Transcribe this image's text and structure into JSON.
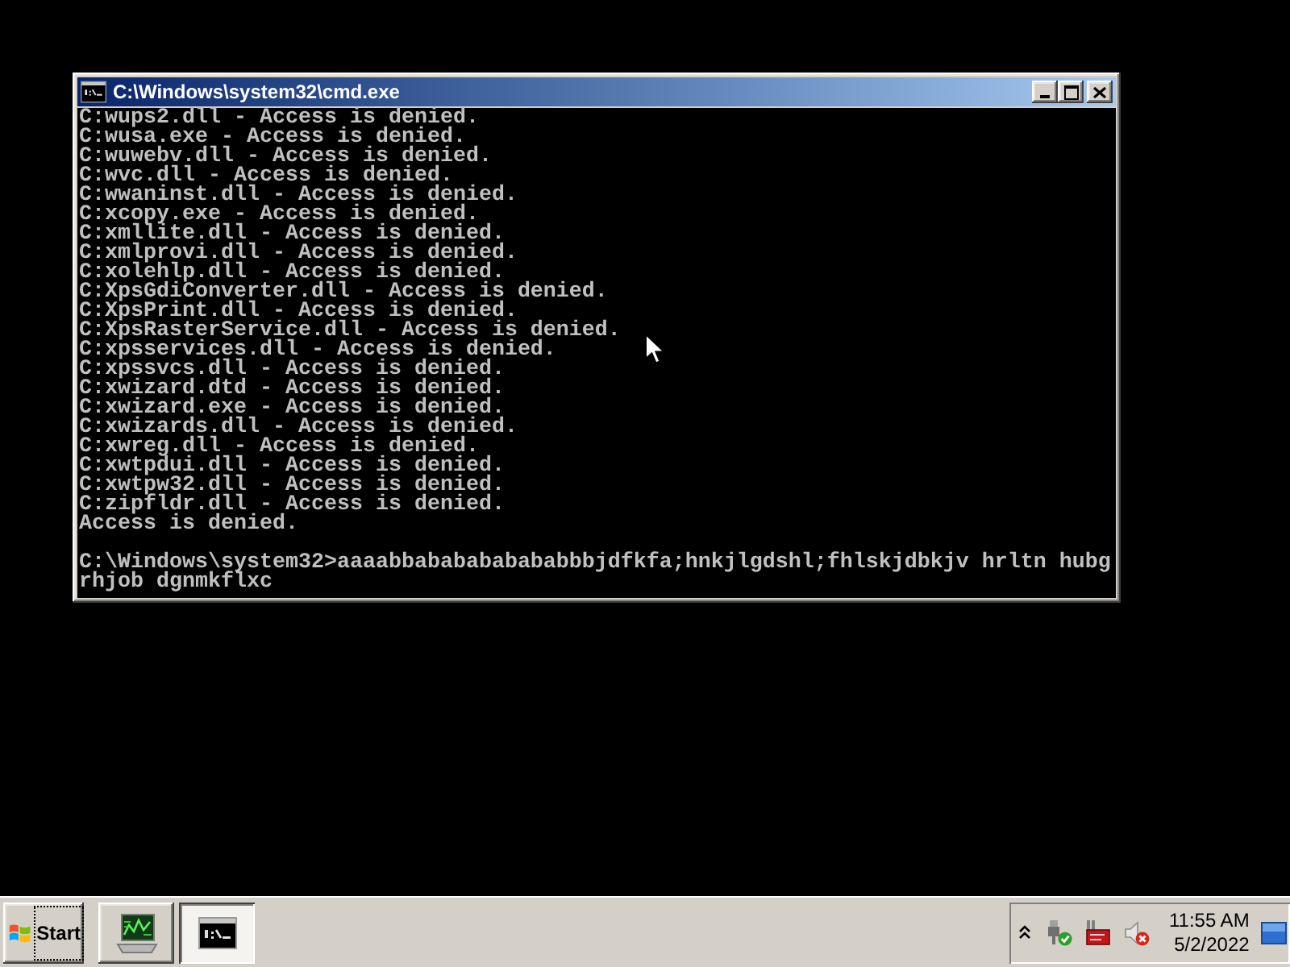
{
  "window": {
    "title": "C:\\Windows\\system32\\cmd.exe"
  },
  "console": {
    "output_lines": [
      "C:wups2.dll - Access is denied.",
      "C:wusa.exe - Access is denied.",
      "C:wuwebv.dll - Access is denied.",
      "C:wvc.dll - Access is denied.",
      "C:wwaninst.dll - Access is denied.",
      "C:xcopy.exe - Access is denied.",
      "C:xmllite.dll - Access is denied.",
      "C:xmlprovi.dll - Access is denied.",
      "C:xolehlp.dll - Access is denied.",
      "C:XpsGdiConverter.dll - Access is denied.",
      "C:XpsPrint.dll - Access is denied.",
      "C:XpsRasterService.dll - Access is denied.",
      "C:xpsservices.dll - Access is denied.",
      "C:xpssvcs.dll - Access is denied.",
      "C:xwizard.dtd - Access is denied.",
      "C:xwizard.exe - Access is denied.",
      "C:xwizards.dll - Access is denied.",
      "C:xwreg.dll - Access is denied.",
      "C:xwtpdui.dll - Access is denied.",
      "C:xwtpw32.dll - Access is denied.",
      "C:zipfldr.dll - Access is denied.",
      "Access is denied."
    ],
    "input_lines": [
      "C:\\Windows\\system32>aaaabbababababababbbjdfkfa;hnkjlgdshl;fhlskjdbkjv hrltn hubg",
      "rhjob dgnmkflxc"
    ]
  },
  "taskbar": {
    "start_label": "Start",
    "buttons": [
      {
        "kind": "server-manager",
        "selected": false
      },
      {
        "kind": "console",
        "selected": true
      }
    ],
    "tray": {
      "time": "11:55 AM",
      "date": "5/2/2022"
    }
  }
}
